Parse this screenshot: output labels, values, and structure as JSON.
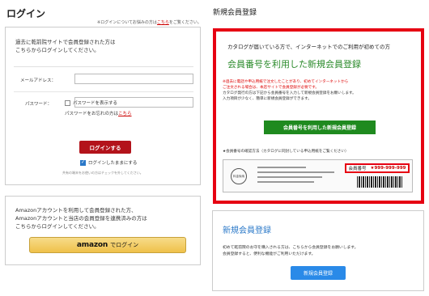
{
  "login": {
    "title": "ログイン",
    "note_prefix": "※ログインについてお悩みの方は",
    "note_link": "こちら",
    "note_suffix": "をご覧ください。",
    "intro_line1": "過去に乾前院サイトで会員登録された方は",
    "intro_line2": "こちらからログインしてください。",
    "email_label": "メールアドレス：",
    "password_label": "パスワード：",
    "show_password_label": "パスワードを表示する",
    "forgot_prefix": "パスワードをお忘れの方は",
    "forgot_link": "こちら",
    "login_button": "ログインする",
    "remember_label": "ログインしたままにする",
    "remember_checked": true,
    "small_note": "共有の端末をお使いの方はチェックを外してください。"
  },
  "amazon": {
    "line1": "Amazonアカウントを利用して会員登録された方、",
    "line2": "Amazonアカウントと当店の会員登録を連携済みの方は",
    "line3": "こちらからログインしてください。",
    "logo_text": "amazon",
    "button_suffix": "でログイン"
  },
  "catalog_registration": {
    "section_title": "新規会員登録",
    "head": "カタログが届いている方で、インターネットでのご利用が初めての方",
    "title": "会員番号を利用した新規会員登録",
    "red_line1": "※過去に電話や申込用紙で注文したことがあり、初めてインターネットから",
    "red_line2": "ご注文される場合は、本店サイトで会員登録が必要です。",
    "black_line1": "カタログ発行の方は下記から会員番号を入力して新規会員登録をお願いします。",
    "black_line2": "入力項目が少なく、簡単に新規会員登録ができます。",
    "button": "会員番号を利用した新規会員登録",
    "card_note": "★会員番号の確認方法（カタログに同封している申込用紙をご覧ください）",
    "card_stamp": "料金後納",
    "member_label": "会員番号",
    "member_number": "★999-999-999"
  },
  "new_registration": {
    "title": "新規会員登録",
    "text_line1": "初めて乾前院のお守を購入される方は、こちらから会員登録をお願いします。",
    "text_line2": "会員登録すると、便利な機能がご利用いただけます。",
    "button": "新規会員登録"
  },
  "colors": {
    "login_button": "#b3131b",
    "catalog_border": "#e60012",
    "green_button": "#1f8a1f",
    "blue_button": "#2a8ae8"
  }
}
